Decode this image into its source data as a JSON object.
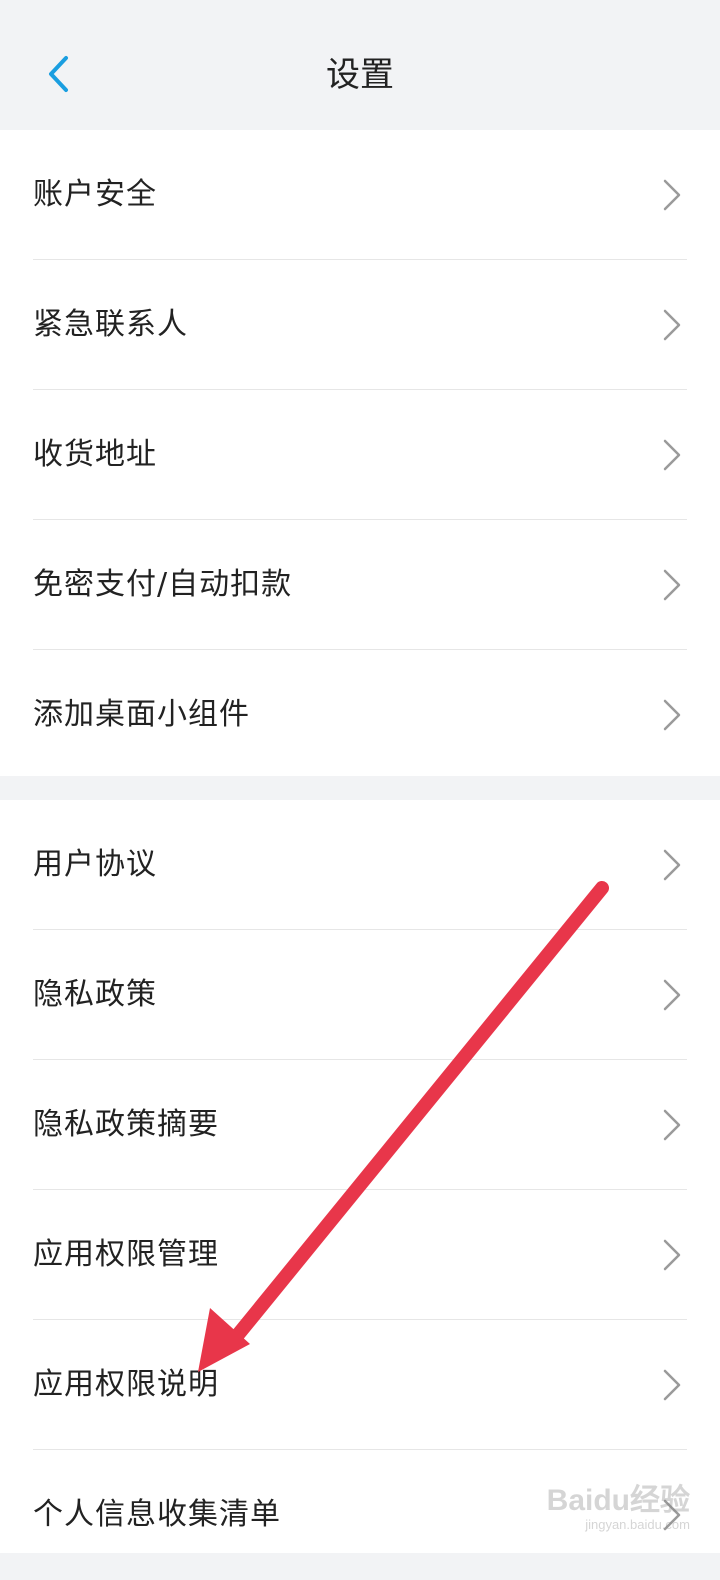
{
  "header": {
    "title": "设置",
    "back_icon": "chevron-left-icon",
    "back_color": "#1a9ee0"
  },
  "group1": {
    "items": [
      {
        "label": "账户安全"
      },
      {
        "label": "紧急联系人"
      },
      {
        "label": "收货地址"
      },
      {
        "label": "免密支付/自动扣款"
      },
      {
        "label": "添加桌面小组件"
      }
    ]
  },
  "group2": {
    "items": [
      {
        "label": "用户协议"
      },
      {
        "label": "隐私政策"
      },
      {
        "label": "隐私政策摘要"
      },
      {
        "label": "应用权限管理"
      },
      {
        "label": "应用权限说明"
      },
      {
        "label": "个人信息收集清单"
      }
    ]
  },
  "annotation": {
    "arrow_color": "#e8364a",
    "points_to": "应用权限说明"
  },
  "watermark": {
    "main": "Baidu经验",
    "sub": "jingyan.baidu.com"
  }
}
